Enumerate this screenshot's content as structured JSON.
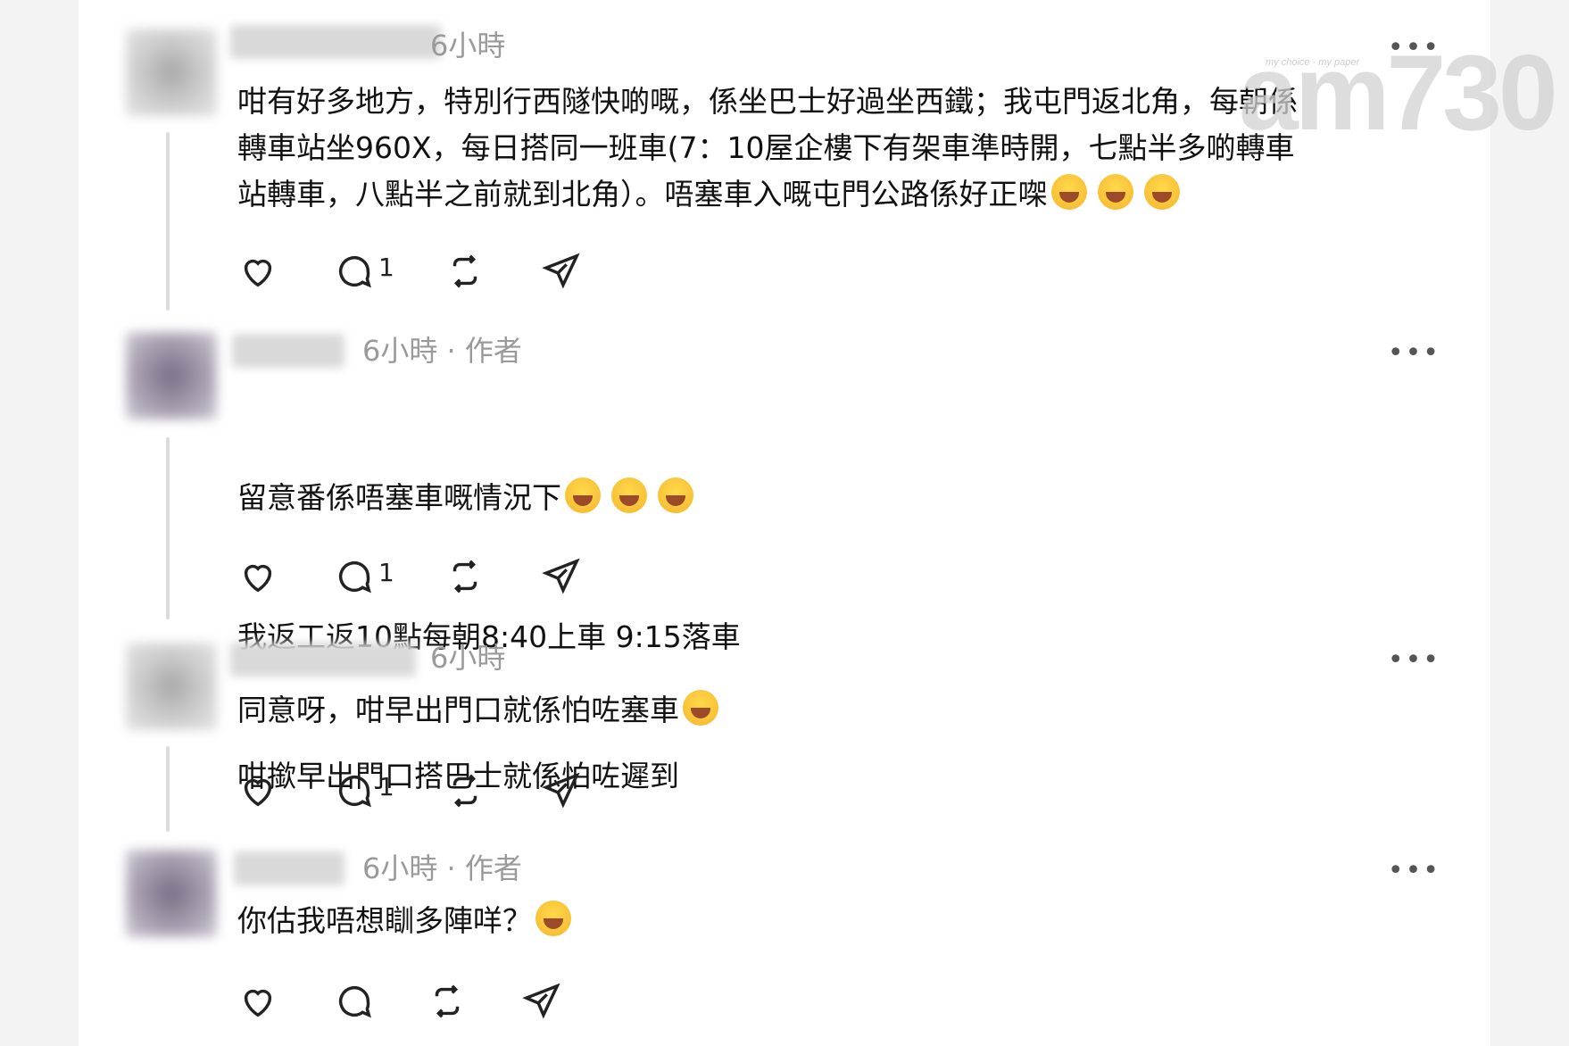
{
  "watermark": {
    "logo": "am730",
    "tagline": "my choice · my paper"
  },
  "posts": [
    {
      "time": "6小時",
      "author_tag": "",
      "text": "咁有好多地方，特別行西隧快啲嘅，係坐巴士好過坐西鐵；我屯門返北角，每朝係\n轉車站坐960X，每日搭同一班車(7：10屋企樓下有架車準時開，七點半多啲轉車\n站轉車，八點半之前就到北角）。唔塞車入嘅屯門公路係好正㗎",
      "reply_count": "1"
    },
    {
      "time": "6小時 · 作者",
      "author_tag": "作者",
      "text_lines": [
        "留意番係唔塞車嘅情況下",
        "我返工返10點每朝8:40上車 9:15落車",
        "咁撳早出門口搭巴士就係怕咗遲到"
      ],
      "reply_count": "1"
    },
    {
      "time": "6小時",
      "author_tag": "",
      "text": "同意呀，咁早出門口就係怕咗塞車",
      "reply_count": "1"
    },
    {
      "time": "6小時 · 作者",
      "author_tag": "作者",
      "text": "你估我唔想瞓多陣咩？",
      "reply_count": ""
    }
  ],
  "icons": [
    "heart-icon",
    "comment-icon",
    "repost-icon",
    "share-icon",
    "more-icon",
    "laughing-emoji"
  ],
  "colors": {
    "meta": "#9a9a9a",
    "text": "#111111",
    "panel": "#ffffff",
    "background": "#f3f3f3"
  }
}
